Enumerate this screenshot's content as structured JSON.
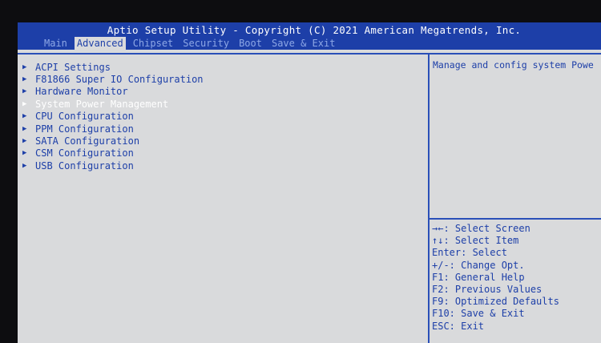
{
  "header": {
    "title": "Aptio Setup Utility - Copyright (C) 2021 American Megatrends, Inc.",
    "tabs": [
      {
        "label": "Main"
      },
      {
        "label": "Advanced"
      },
      {
        "label": "Chipset"
      },
      {
        "label": "Security"
      },
      {
        "label": "Boot"
      },
      {
        "label": "Save & Exit"
      }
    ],
    "active_tab": "Advanced"
  },
  "menu": {
    "items": [
      {
        "label": "ACPI Settings"
      },
      {
        "label": "F81866 Super IO Configuration"
      },
      {
        "label": "Hardware Monitor"
      },
      {
        "label": "System Power Management"
      },
      {
        "label": "CPU Configuration"
      },
      {
        "label": "PPM Configuration"
      },
      {
        "label": "SATA Configuration"
      },
      {
        "label": "CSM Configuration"
      },
      {
        "label": "USB Configuration"
      }
    ],
    "selected": "System Power Management"
  },
  "help": {
    "text": "Manage and config system Powe"
  },
  "keys": [
    "→←: Select Screen",
    "↑↓: Select Item",
    "Enter: Select",
    "+/-: Change Opt.",
    "F1: General Help",
    "F2: Previous Values",
    "F9: Optimized Defaults",
    "F10: Save & Exit",
    "ESC: Exit"
  ],
  "colors": {
    "header_bg": "#1d3fa8",
    "panel_bg": "#d9dadc",
    "text_blue": "#1d3fa8",
    "selected_text": "#ffffff",
    "inactive_tab": "#8ea8e6"
  },
  "icons": {
    "menu_arrow": "triangle-right-icon"
  }
}
